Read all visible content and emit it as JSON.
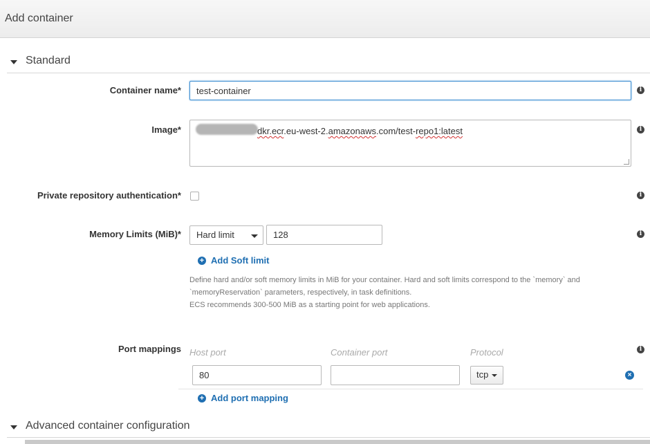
{
  "header": {
    "title": "Add container"
  },
  "sections": {
    "standard": "Standard",
    "advanced": "Advanced container configuration"
  },
  "fields": {
    "container_name": {
      "label": "Container name*",
      "value": "test-container"
    },
    "image": {
      "label": "Image*",
      "value_prefix": "dkr.ecr",
      "value_mid": ".eu-west-2.",
      "value_domain": "amazonaws",
      "value_after_domain": ".com/test-",
      "value_repo": "repo1:latest"
    },
    "private_repo_auth": {
      "label": "Private repository authentication*",
      "checked": false
    },
    "memory_limits": {
      "label": "Memory Limits (MiB)*",
      "type_selected": "Hard limit",
      "value": "128",
      "add_soft_limit": "Add Soft limit",
      "help_line1": "Define hard and/or soft memory limits in MiB for your container. Hard and soft limits correspond to the `memory` and",
      "help_line2": "`memoryReservation` parameters, respectively, in task definitions.",
      "help_line3": "ECS recommends 300-500 MiB as a starting point for web applications."
    },
    "port_mappings": {
      "label": "Port mappings",
      "col_host": "Host port",
      "col_container": "Container port",
      "col_protocol": "Protocol",
      "rows": [
        {
          "host_port": "80",
          "container_port": "",
          "protocol": "tcp"
        }
      ],
      "add_port_mapping": "Add port mapping"
    }
  },
  "icons": {
    "info": "i",
    "plus": "+",
    "remove": "×"
  },
  "colors": {
    "link": "#1f6fb2",
    "focus_border": "#3f8fd2"
  }
}
